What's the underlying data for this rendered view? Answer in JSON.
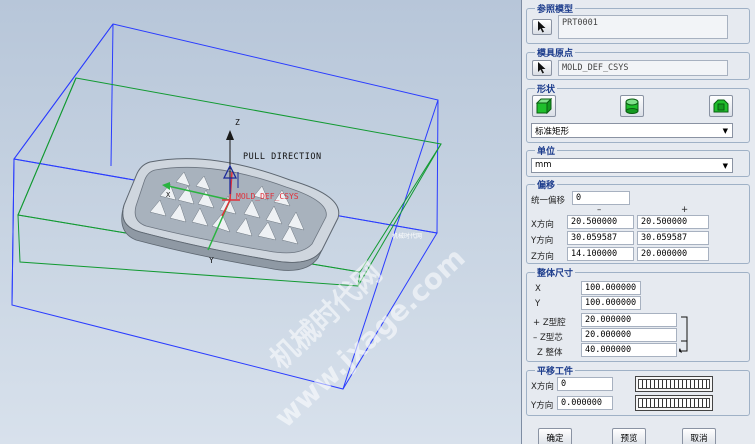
{
  "viewport": {
    "pull_direction": "PULL DIRECTION",
    "csys_label": "MOLD_DEF_CSYS",
    "z_label": "Z",
    "y_label": "Y",
    "x_label": "X",
    "small_text": "机械时代网",
    "watermark_line1": "机械时代网",
    "watermark_line2": "www.jxage.com"
  },
  "panel": {
    "ref_model": {
      "title": "参照模型",
      "value": "PRT0001"
    },
    "origin": {
      "title": "模具原点",
      "value": "MOLD_DEF_CSYS"
    },
    "shape": {
      "title": "形状",
      "selected": "标准矩形"
    },
    "unit": {
      "title": "单位",
      "selected": "mm"
    },
    "offset": {
      "title": "偏移",
      "uniform_label": "统一偏移",
      "uniform_value": "0",
      "minus_label": "–",
      "plus_label": "+",
      "rows": [
        {
          "label": "X方向",
          "minus": "20.500000",
          "plus": "20.500000"
        },
        {
          "label": "Y方向",
          "minus": "30.059587",
          "plus": "30.059587"
        },
        {
          "label": "Z方向",
          "minus": "14.100000",
          "plus": "20.000000"
        }
      ]
    },
    "overall": {
      "title": "整体尺寸",
      "x_label": "X",
      "x_value": "100.000000",
      "y_label": "Y",
      "y_value": "100.000000",
      "z_cavity_label": "+ Z型腔",
      "z_cavity_value": "20.000000",
      "z_core_label": "– Z型芯",
      "z_core_value": "20.000000",
      "z_total_label": "Z 整体",
      "z_total_value": "40.000000"
    },
    "translate": {
      "title": "平移工件",
      "x_label": "X方向",
      "x_value": "0",
      "y_label": "Y方向",
      "y_value": "0.000000"
    },
    "buttons": {
      "ok": "确定",
      "preview": "预览",
      "cancel": "取消"
    }
  },
  "colors": {
    "workpiece_box": "#2a3cff",
    "parting_box": "#129a32",
    "title_blue": "#1c3c8c",
    "shape_green": "#1fbf2c"
  }
}
